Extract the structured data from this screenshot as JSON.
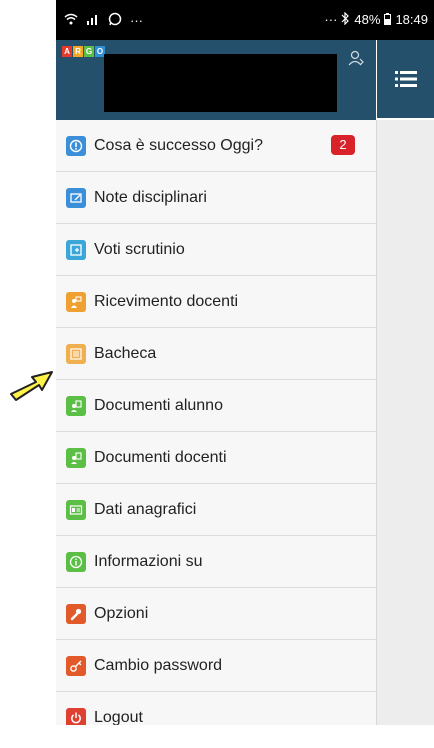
{
  "statusbar": {
    "battery": "48%",
    "time": "18:49",
    "dots_left": "···",
    "dots_right": "···"
  },
  "app": {
    "logo_letters": [
      "A",
      "R",
      "G",
      "O"
    ]
  },
  "menu": [
    {
      "label": "Cosa è successo Oggi?",
      "icon": "info-icon",
      "color": "#3a8fd8",
      "badge": "2"
    },
    {
      "label": "Note disciplinari",
      "icon": "note-icon",
      "color": "#3a8fd8"
    },
    {
      "label": "Voti scrutinio",
      "icon": "grades-icon",
      "color": "#3aa7d8"
    },
    {
      "label": "Ricevimento docenti",
      "icon": "teacher-icon",
      "color": "#f0a030"
    },
    {
      "label": "Bacheca",
      "icon": "board-icon",
      "color": "#f0b050"
    },
    {
      "label": "Documenti alunno",
      "icon": "student-docs-icon",
      "color": "#5cbf45"
    },
    {
      "label": "Documenti docenti",
      "icon": "teacher-docs-icon",
      "color": "#5cbf45"
    },
    {
      "label": "Dati anagrafici",
      "icon": "id-card-icon",
      "color": "#5cbf45"
    },
    {
      "label": "Informazioni su",
      "icon": "info-circle-icon",
      "color": "#5cbf45"
    },
    {
      "label": "Opzioni",
      "icon": "wrench-icon",
      "color": "#e25a2a"
    },
    {
      "label": "Cambio password",
      "icon": "key-icon",
      "color": "#e25a2a"
    },
    {
      "label": "Logout",
      "icon": "power-icon",
      "color": "#e04030"
    }
  ]
}
